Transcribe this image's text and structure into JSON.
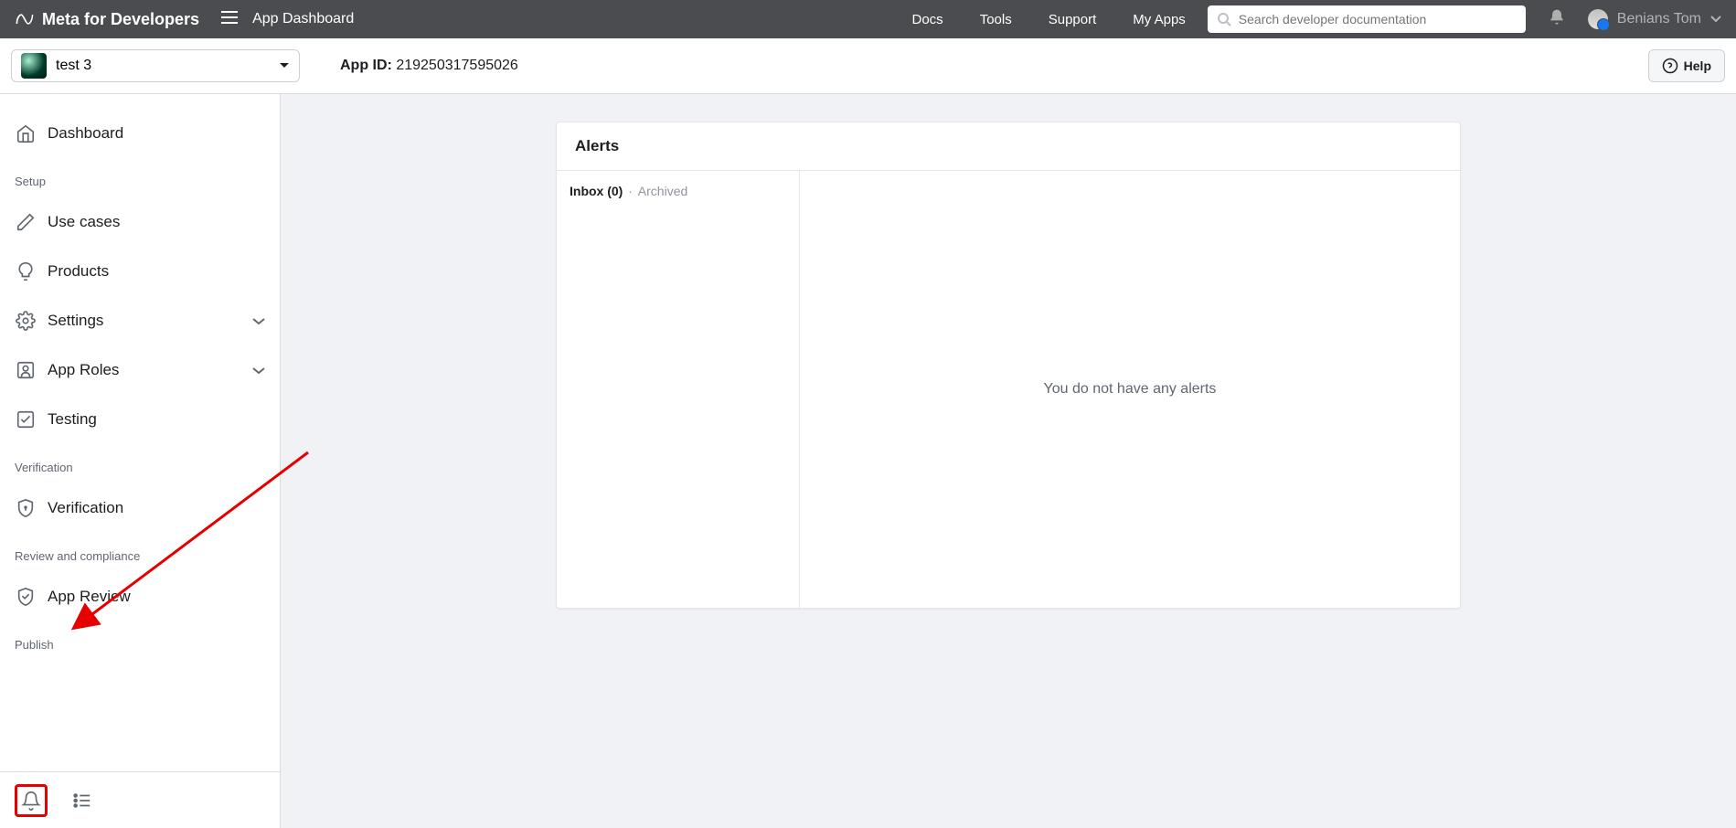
{
  "header": {
    "brand": "Meta for Developers",
    "page_title": "App Dashboard",
    "nav": [
      "Docs",
      "Tools",
      "Support",
      "My Apps"
    ],
    "search_placeholder": "Search developer documentation",
    "user_name": "Benians Tom"
  },
  "subheader": {
    "app_name": "test 3",
    "app_id_label": "App ID: ",
    "app_id_value": "219250317595026",
    "help_label": "Help"
  },
  "sidebar": {
    "items_top": [
      {
        "label": "Dashboard",
        "icon": "home"
      }
    ],
    "sections": [
      {
        "header": "Setup",
        "items": [
          {
            "label": "Use cases",
            "icon": "pencil"
          },
          {
            "label": "Products",
            "icon": "bulb"
          },
          {
            "label": "Settings",
            "icon": "gear",
            "chevron": true
          },
          {
            "label": "App Roles",
            "icon": "users",
            "chevron": true
          },
          {
            "label": "Testing",
            "icon": "check-square"
          }
        ]
      },
      {
        "header": "Verification",
        "items": [
          {
            "label": "Verification",
            "icon": "shield"
          }
        ]
      },
      {
        "header": "Review and compliance",
        "items": [
          {
            "label": "App Review",
            "icon": "badge"
          }
        ]
      },
      {
        "header": "Publish",
        "items": []
      }
    ]
  },
  "alerts": {
    "title": "Alerts",
    "inbox_label": "Inbox (0)",
    "archived_label": "Archived",
    "empty_message": "You do not have any alerts"
  }
}
